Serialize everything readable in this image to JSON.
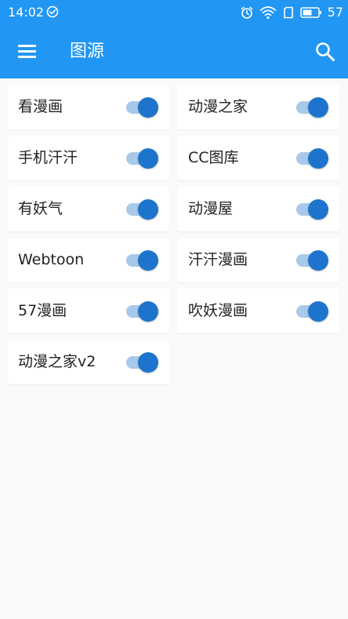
{
  "status_bar": {
    "time": "14:02",
    "battery_percent": "57"
  },
  "app_bar": {
    "title": "图源"
  },
  "sources": [
    {
      "label": "看漫画",
      "enabled": true
    },
    {
      "label": "动漫之家",
      "enabled": true
    },
    {
      "label": "手机汗汗",
      "enabled": true
    },
    {
      "label": "CC图库",
      "enabled": true
    },
    {
      "label": "有妖气",
      "enabled": true
    },
    {
      "label": "动漫屋",
      "enabled": true
    },
    {
      "label": "Webtoon",
      "enabled": true
    },
    {
      "label": "汗汗漫画",
      "enabled": true
    },
    {
      "label": "57漫画",
      "enabled": true
    },
    {
      "label": "吹妖漫画",
      "enabled": true
    },
    {
      "label": "动漫之家v2",
      "enabled": true
    }
  ],
  "colors": {
    "primary": "#2196f3",
    "switch_thumb": "#1e74cc",
    "switch_track": "#a9c9ea",
    "background": "#fafafa",
    "card": "#ffffff"
  }
}
